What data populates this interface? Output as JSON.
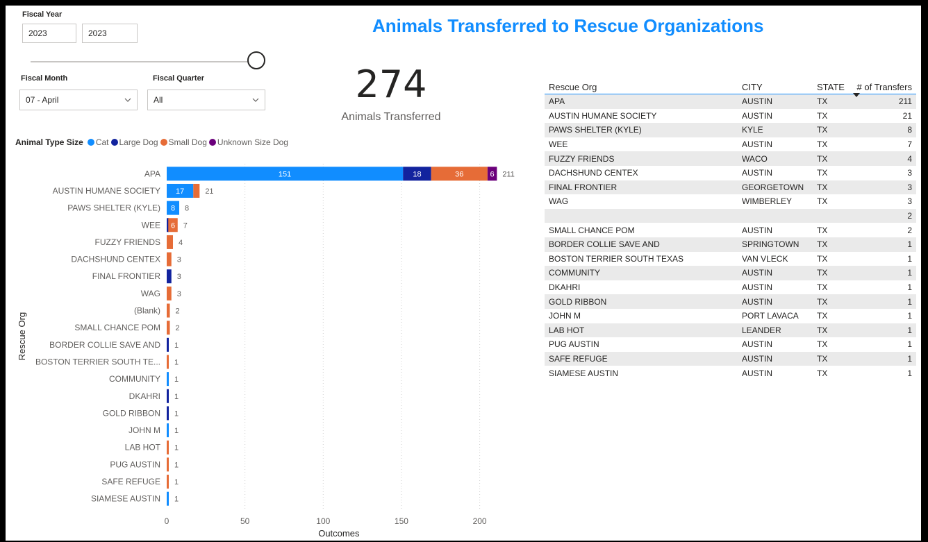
{
  "filters": {
    "fiscal_year_label": "Fiscal Year",
    "year_start": "2023",
    "year_end": "2023",
    "slider_value": 1.0,
    "fiscal_month_label": "Fiscal Month",
    "fiscal_month_value": "07 - April",
    "fiscal_quarter_label": "Fiscal Quarter",
    "fiscal_quarter_value": "All"
  },
  "title": "Animals Transferred to Rescue Organizations",
  "kpi": {
    "value": "274",
    "label": "Animals Transferred"
  },
  "legend": {
    "title": "Animal Type Size",
    "items": [
      {
        "name": "Cat",
        "color": "#118dff"
      },
      {
        "name": "Large Dog",
        "color": "#12239e"
      },
      {
        "name": "Small Dog",
        "color": "#e66c37"
      },
      {
        "name": "Unknown Size Dog",
        "color": "#6b007b"
      }
    ]
  },
  "chart_data": {
    "type": "bar",
    "orientation": "horizontal",
    "stacked": true,
    "xlabel": "Outcomes",
    "ylabel": "Rescue Org",
    "xlim": [
      0,
      220
    ],
    "x_ticks": [
      0,
      50,
      100,
      150,
      200
    ],
    "grid": true,
    "legend_position": "top-left",
    "categories": [
      "APA",
      "AUSTIN HUMANE SOCIETY",
      "PAWS SHELTER (KYLE)",
      "WEE",
      "FUZZY FRIENDS",
      "DACHSHUND CENTEX",
      "FINAL FRONTIER",
      "WAG",
      "(Blank)",
      "SMALL CHANCE POM",
      "BORDER COLLIE SAVE AND",
      "BOSTON TERRIER SOUTH TE...",
      "COMMUNITY",
      "DKAHRI",
      "GOLD RIBBON",
      "JOHN M",
      "LAB HOT",
      "PUG AUSTIN",
      "SAFE REFUGE",
      "SIAMESE AUSTIN"
    ],
    "series": [
      {
        "name": "Cat",
        "color": "#118dff",
        "values": [
          151,
          17,
          8,
          0,
          0,
          0,
          0,
          0,
          0,
          0,
          0,
          0,
          1,
          0,
          0,
          1,
          0,
          0,
          0,
          1
        ]
      },
      {
        "name": "Large Dog",
        "color": "#12239e",
        "values": [
          18,
          0,
          0,
          1,
          0,
          0,
          3,
          0,
          0,
          0,
          1,
          0,
          0,
          1,
          1,
          0,
          0,
          0,
          0,
          0
        ]
      },
      {
        "name": "Small Dog",
        "color": "#e66c37",
        "values": [
          36,
          4,
          0,
          6,
          4,
          3,
          0,
          3,
          2,
          2,
          0,
          1,
          0,
          0,
          0,
          0,
          1,
          1,
          1,
          0
        ]
      },
      {
        "name": "Unknown Size Dog",
        "color": "#6b007b",
        "values": [
          6,
          0,
          0,
          0,
          0,
          0,
          0,
          0,
          0,
          0,
          0,
          0,
          0,
          0,
          0,
          0,
          0,
          0,
          0,
          0
        ]
      }
    ],
    "segment_labels": [
      [
        "151",
        "18",
        "36",
        "6"
      ],
      [
        "17",
        "",
        "",
        ""
      ],
      [
        "8",
        "",
        "",
        ""
      ],
      [
        "",
        "",
        "6",
        ""
      ]
    ],
    "totals": [
      "211",
      "21",
      "8",
      "7",
      "4",
      "3",
      "3",
      "3",
      "2",
      "2",
      "1",
      "1",
      "1",
      "1",
      "1",
      "1",
      "1",
      "1",
      "1",
      "1"
    ]
  },
  "table": {
    "headers": [
      "Rescue Org",
      "CITY",
      "STATE",
      "# of Transfers"
    ],
    "rows": [
      [
        "APA",
        "AUSTIN",
        "TX",
        "211"
      ],
      [
        "AUSTIN HUMANE SOCIETY",
        "AUSTIN",
        "TX",
        "21"
      ],
      [
        "PAWS SHELTER (KYLE)",
        "KYLE",
        "TX",
        "8"
      ],
      [
        "WEE",
        "AUSTIN",
        "TX",
        "7"
      ],
      [
        "FUZZY FRIENDS",
        "WACO",
        "TX",
        "4"
      ],
      [
        "DACHSHUND CENTEX",
        "AUSTIN",
        "TX",
        "3"
      ],
      [
        "FINAL FRONTIER",
        "GEORGETOWN",
        "TX",
        "3"
      ],
      [
        "WAG",
        "WIMBERLEY",
        "TX",
        "3"
      ],
      [
        "",
        "",
        "",
        "2"
      ],
      [
        "SMALL CHANCE POM",
        "AUSTIN",
        "TX",
        "2"
      ],
      [
        "BORDER COLLIE SAVE AND",
        "SPRINGTOWN",
        "TX",
        "1"
      ],
      [
        "BOSTON TERRIER SOUTH TEXAS",
        "VAN VLECK",
        "TX",
        "1"
      ],
      [
        "COMMUNITY",
        "AUSTIN",
        "TX",
        "1"
      ],
      [
        "DKAHRI",
        "AUSTIN",
        "TX",
        "1"
      ],
      [
        "GOLD RIBBON",
        "AUSTIN",
        "TX",
        "1"
      ],
      [
        "JOHN M",
        "PORT LAVACA",
        "TX",
        "1"
      ],
      [
        "LAB HOT",
        "LEANDER",
        "TX",
        "1"
      ],
      [
        "PUG AUSTIN",
        "AUSTIN",
        "TX",
        "1"
      ],
      [
        "SAFE REFUGE",
        "AUSTIN",
        "TX",
        "1"
      ],
      [
        "SIAMESE AUSTIN",
        "AUSTIN",
        "TX",
        "1"
      ]
    ]
  }
}
